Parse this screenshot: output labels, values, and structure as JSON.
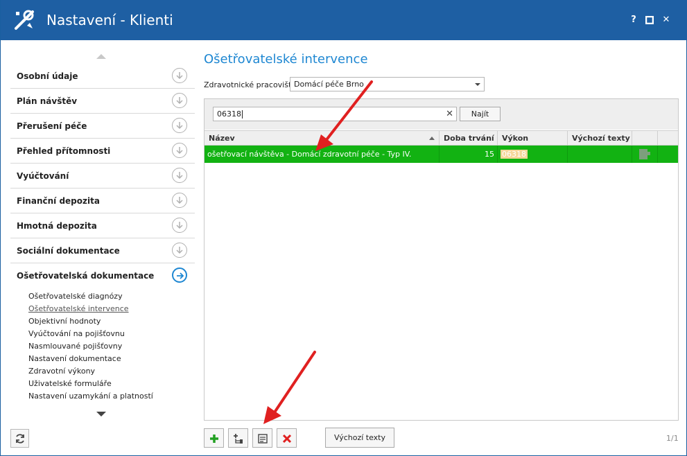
{
  "window": {
    "title": "Nastavení - Klienti",
    "help_label": "?",
    "close_label": "✕"
  },
  "sidebar": {
    "sections": [
      {
        "label": "Osobní údaje"
      },
      {
        "label": "Plán návštěv"
      },
      {
        "label": "Přerušení péče"
      },
      {
        "label": "Přehled přítomnosti"
      },
      {
        "label": "Vyúčtování"
      },
      {
        "label": "Finanční depozita"
      },
      {
        "label": "Hmotná depozita"
      },
      {
        "label": "Sociální dokumentace"
      },
      {
        "label": "Ošetřovatelská dokumentace"
      }
    ],
    "subitems": [
      {
        "label": "Ošetřovatelské diagnózy"
      },
      {
        "label": "Ošetřovatelské intervence"
      },
      {
        "label": "Objektivní hodnoty"
      },
      {
        "label": "Vyúčtování na pojišťovnu"
      },
      {
        "label": "Nasmlouvané pojišťovny"
      },
      {
        "label": "Nastavení dokumentace"
      },
      {
        "label": "Zdravotní výkony"
      },
      {
        "label": "Uživatelské formuláře"
      },
      {
        "label": "Nastavení uzamykání a platností"
      }
    ]
  },
  "main": {
    "title": "Ošetřovatelské intervence",
    "workplace_label": "Zdravotnické pracoviště:",
    "workplace_value": "Domácí péče Brno",
    "search_value": "06318",
    "find_button": "Najít",
    "grid": {
      "columns": [
        "Název",
        "Doba trvání",
        "Výkon",
        "Výchozí texty"
      ],
      "rows": [
        {
          "nazev": "ošetřovací návštěva - Domácí zdravotní péče - Typ IV.",
          "doba": "15",
          "vykon": "06318",
          "texty": ""
        }
      ]
    },
    "default_texts_button": "Výchozí texty",
    "pager": "1/1"
  },
  "colors": {
    "titlebar": "#1e5fa3",
    "accent": "#1e87d2",
    "row_selected": "#12b212",
    "annotation_arrow": "#e02020"
  }
}
